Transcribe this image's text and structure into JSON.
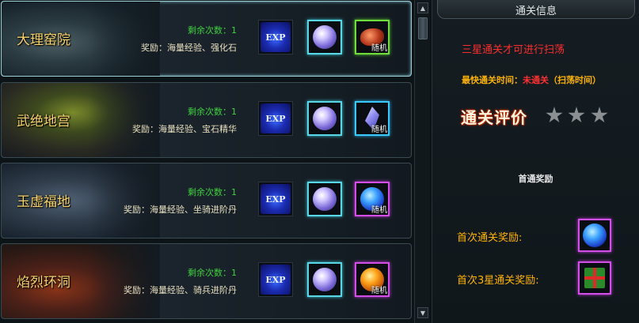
{
  "cards": [
    {
      "title": "大理窑院",
      "remain": "剩余次数：1",
      "reward": "奖励：海量经验、强化石",
      "exp_label": "EXP",
      "random_label": "随机",
      "random_item": "meat-icon",
      "random_frame": "green"
    },
    {
      "title": "武绝地宫",
      "remain": "剩余次数：1",
      "reward": "奖励：海量经验、宝石精华",
      "exp_label": "EXP",
      "random_label": "随机",
      "random_item": "crystal-icon",
      "random_frame": "cyan"
    },
    {
      "title": "玉虚福地",
      "remain": "剩余次数：1",
      "reward": "奖励：海量经验、坐骑进阶丹",
      "exp_label": "EXP",
      "random_label": "随机",
      "random_item": "blue-sphere-icon",
      "random_frame": "purple"
    },
    {
      "title": "焰烈环洞",
      "remain": "剩余次数：1",
      "reward": "奖励：海量经验、骑兵进阶丹",
      "exp_label": "EXP",
      "random_label": "随机",
      "random_item": "fire-sphere-icon",
      "random_frame": "purple"
    }
  ],
  "panel": {
    "title": "通关信息",
    "warning": "三星通关才可进行扫荡",
    "fastest_label": "最快通关时间：",
    "fastest_value": "未通关",
    "fastest_suffix": "（扫荡时间）",
    "rating_label": "通关评价",
    "stars_earned": 0,
    "stars_total": 3,
    "first_reward_heading": "首通奖励",
    "first_clear_label": "首次通关奖励:",
    "first_3star_label": "首次3星通关奖励:"
  },
  "colors": {
    "title": "#f6d36b",
    "remain": "#3fd13f",
    "warning": "#ff2d2d",
    "gold": "#ffb400"
  }
}
